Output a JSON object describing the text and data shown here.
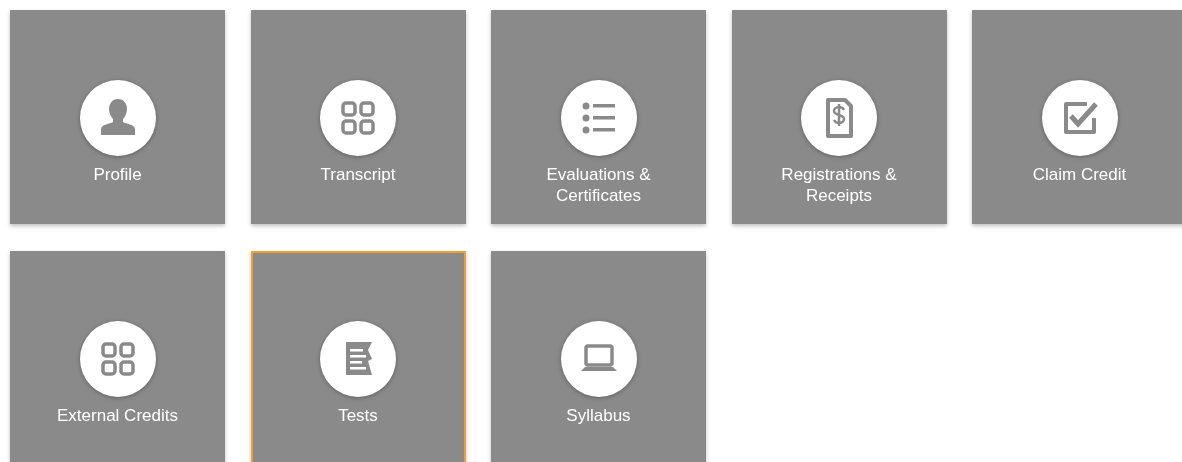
{
  "tiles": [
    {
      "label": "Profile",
      "kind": "person",
      "selected": false
    },
    {
      "label": "Transcript",
      "kind": "grid",
      "selected": false
    },
    {
      "label": "Evaluations & Certificates",
      "kind": "list",
      "selected": false
    },
    {
      "label": "Registrations & Receipts",
      "kind": "receipt",
      "selected": false
    },
    {
      "label": "Claim Credit",
      "kind": "checkbox",
      "selected": false
    },
    {
      "label": "External Credits",
      "kind": "grid",
      "selected": false
    },
    {
      "label": "Tests",
      "kind": "test",
      "selected": true
    },
    {
      "label": "Syllabus",
      "kind": "laptop",
      "selected": false
    }
  ]
}
